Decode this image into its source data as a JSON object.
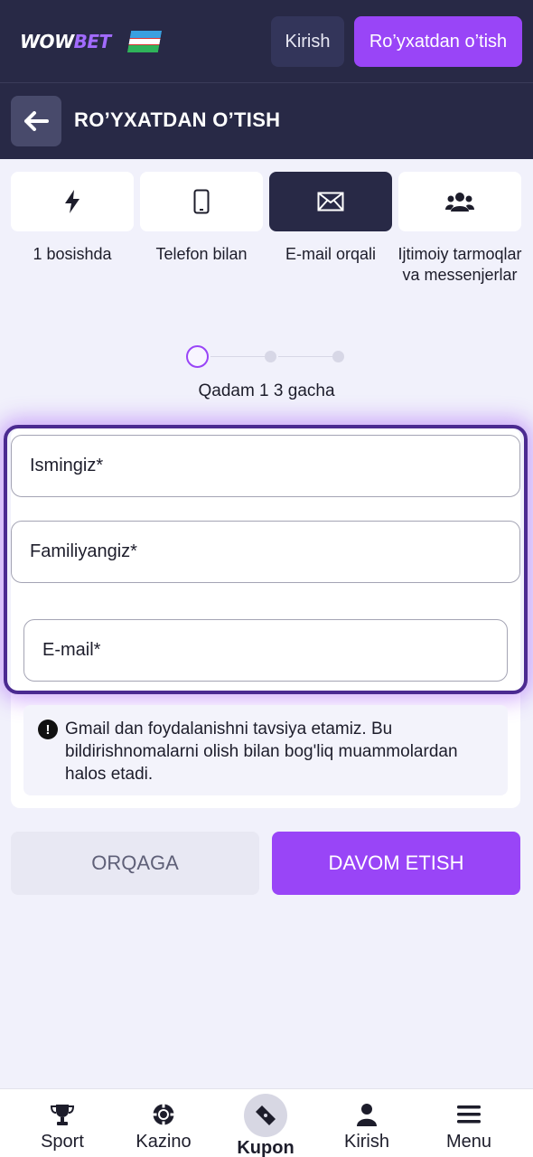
{
  "header": {
    "logo_part1": "WOW",
    "logo_part2": "BET",
    "login_label": "Kirish",
    "register_label": "Ro’yxatdan o’tish"
  },
  "subheader": {
    "title": "RO’YXATDAN O’TISH"
  },
  "methods": [
    {
      "label": "1 bosishda",
      "icon": "lightning-icon",
      "active": false
    },
    {
      "label": "Telefon bilan",
      "icon": "phone-icon",
      "active": false
    },
    {
      "label": "E-mail orqali",
      "icon": "envelope-icon",
      "active": true
    },
    {
      "label": "Ijtimoiy tarmoqlar va messenjerlar",
      "icon": "users-icon",
      "active": false
    }
  ],
  "stepper": {
    "text": "Qadam 1 3 gacha",
    "current": 1,
    "total": 3
  },
  "form": {
    "first_name_placeholder": "Ismingiz*",
    "last_name_placeholder": "Familiyangiz*",
    "email_placeholder": "E-mail*",
    "info_text": "Gmail dan foydalanishni tavsiya etamiz. Bu bildirishnomalarni olish bilan bog'liq muammolardan halos etadi."
  },
  "actions": {
    "back_label": "ORQAGA",
    "next_label": "DAVOM ETISH"
  },
  "bottom_nav": [
    {
      "label": "Sport",
      "icon": "trophy-icon"
    },
    {
      "label": "Kazino",
      "icon": "casino-chip-icon"
    },
    {
      "label": "Kupon",
      "icon": "ticket-icon"
    },
    {
      "label": "Kirish",
      "icon": "user-icon"
    },
    {
      "label": "Menu",
      "icon": "menu-icon"
    }
  ],
  "colors": {
    "header_bg": "#282946",
    "accent": "#9945f7",
    "page_bg": "#f1f1fb"
  }
}
